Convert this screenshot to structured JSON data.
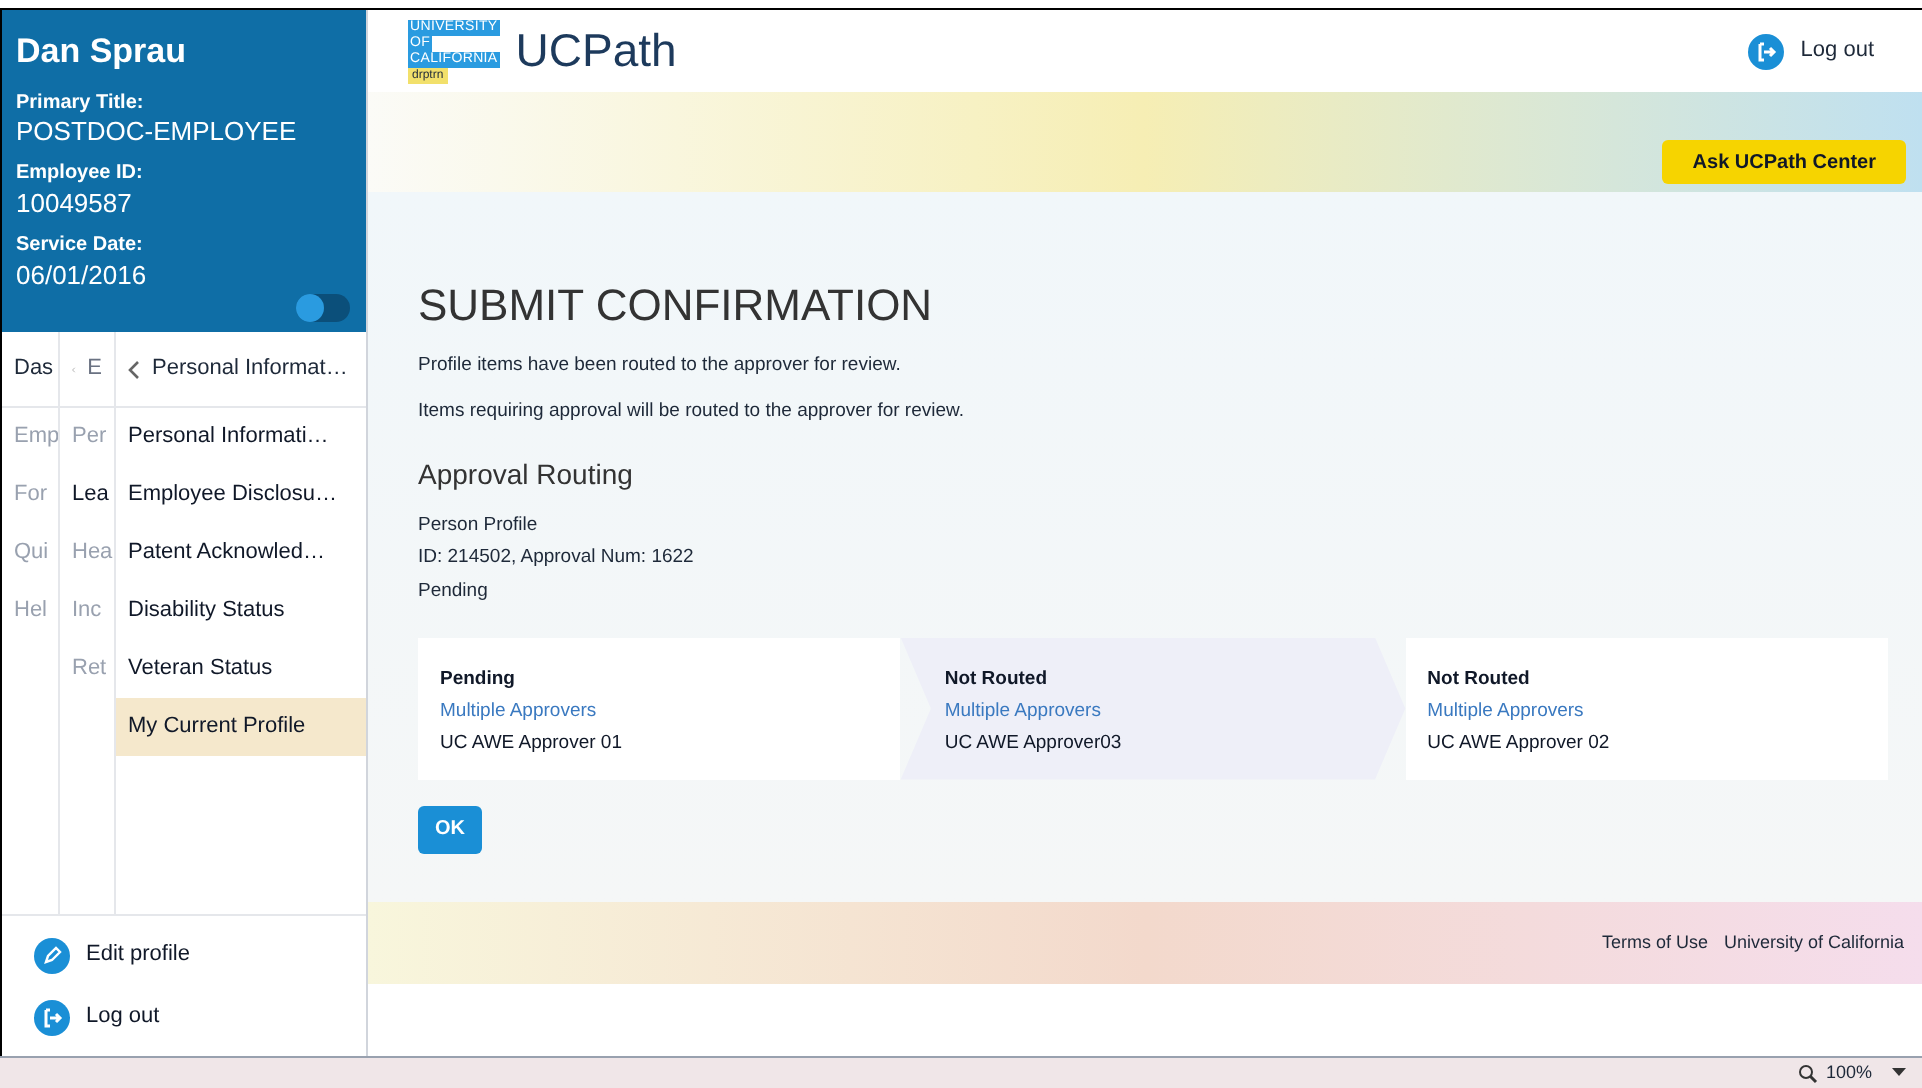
{
  "profile": {
    "name": "Dan Sprau",
    "fields": [
      {
        "label": "Primary Title:",
        "value": "POSTDOC-EMPLOYEE"
      },
      {
        "label": "Employee ID:",
        "value": "10049587"
      },
      {
        "label": "Service Date:",
        "value": "06/01/2016"
      }
    ],
    "toggle_on": false
  },
  "nav_columns": [
    {
      "kind": "root",
      "header": "Das",
      "items": [
        {
          "label": "Emp",
          "selected": false
        },
        {
          "label": "For",
          "selected": false
        },
        {
          "label": "Qui",
          "selected": false
        },
        {
          "label": "Hel",
          "selected": false
        }
      ]
    },
    {
      "kind": "parent",
      "header": "E",
      "items": [
        {
          "label": "Per",
          "selected": false
        },
        {
          "label": "Lea",
          "selected": true
        },
        {
          "label": "Hea",
          "selected": false
        },
        {
          "label": "Inc",
          "selected": false
        },
        {
          "label": "Ret",
          "selected": false
        }
      ]
    },
    {
      "kind": "current",
      "header": "Personal Informat…",
      "items": [
        {
          "label": "Personal Informati…",
          "selected": false
        },
        {
          "label": "Employee Disclosu…",
          "selected": false
        },
        {
          "label": "Patent Acknowled…",
          "selected": false
        },
        {
          "label": "Disability Status",
          "selected": false
        },
        {
          "label": "Veteran Status",
          "selected": false
        },
        {
          "label": "My Current Profile",
          "selected": true
        }
      ]
    }
  ],
  "sidebar_actions": [
    {
      "kind": "edit",
      "label": "Edit profile"
    },
    {
      "kind": "logout",
      "label": "Log out"
    }
  ],
  "header": {
    "logo_lines": [
      "UNIVERSITY",
      "OF",
      "CALIFORNIA"
    ],
    "logo_tag": "drptrn",
    "app_name": "UCPath",
    "logout": "Log out"
  },
  "ask_button": "Ask UCPath Center",
  "title": "SUBMIT CONFIRMATION",
  "messages": [
    "Profile items have been routed to the approver for review.",
    "Items requiring approval will be routed to the approver for review."
  ],
  "routing": {
    "heading": "Approval Routing",
    "details": [
      "Person Profile",
      "ID: 214502, Approval Num: 1622",
      "Pending"
    ],
    "steps": [
      {
        "status": "Pending",
        "link": "Multiple Approvers",
        "approver": "UC AWE Approver 01",
        "selected": false
      },
      {
        "status": "Not Routed",
        "link": "Multiple Approvers",
        "approver": "UC AWE Approver03",
        "selected": true
      },
      {
        "status": "Not Routed",
        "link": "Multiple Approvers",
        "approver": "UC AWE Approver 02",
        "selected": false
      }
    ]
  },
  "ok_button": "OK",
  "footer_links": [
    "Terms of Use",
    "University of California"
  ],
  "status_bar": {
    "zoom": "100%"
  }
}
